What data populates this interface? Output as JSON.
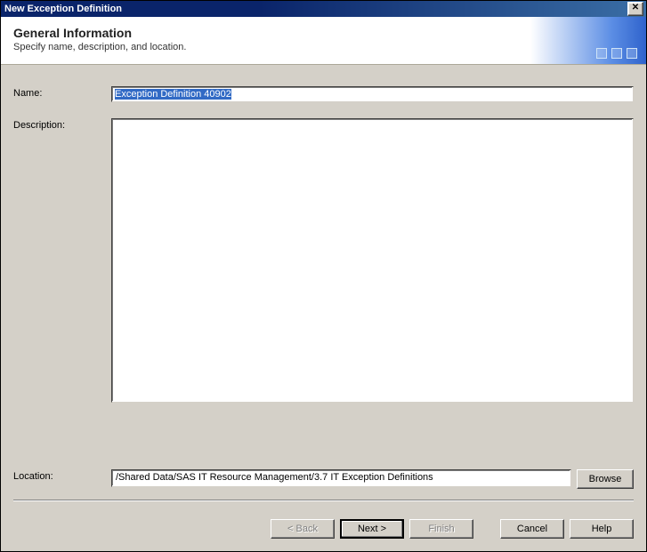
{
  "window": {
    "title": "New Exception Definition"
  },
  "header": {
    "heading": "General Information",
    "subheading": "Specify name, description, and location."
  },
  "labels": {
    "name": "Name:",
    "description": "Description:",
    "location": "Location:"
  },
  "fields": {
    "name_value": "Exception Definition 40902",
    "description_value": "",
    "location_value": "/Shared Data/SAS IT Resource Management/3.7 IT Exception Definitions"
  },
  "buttons": {
    "browse": "Browse",
    "back": "< Back",
    "next": "Next >",
    "finish": "Finish",
    "cancel": "Cancel",
    "help": "Help",
    "close_glyph": "✕"
  }
}
